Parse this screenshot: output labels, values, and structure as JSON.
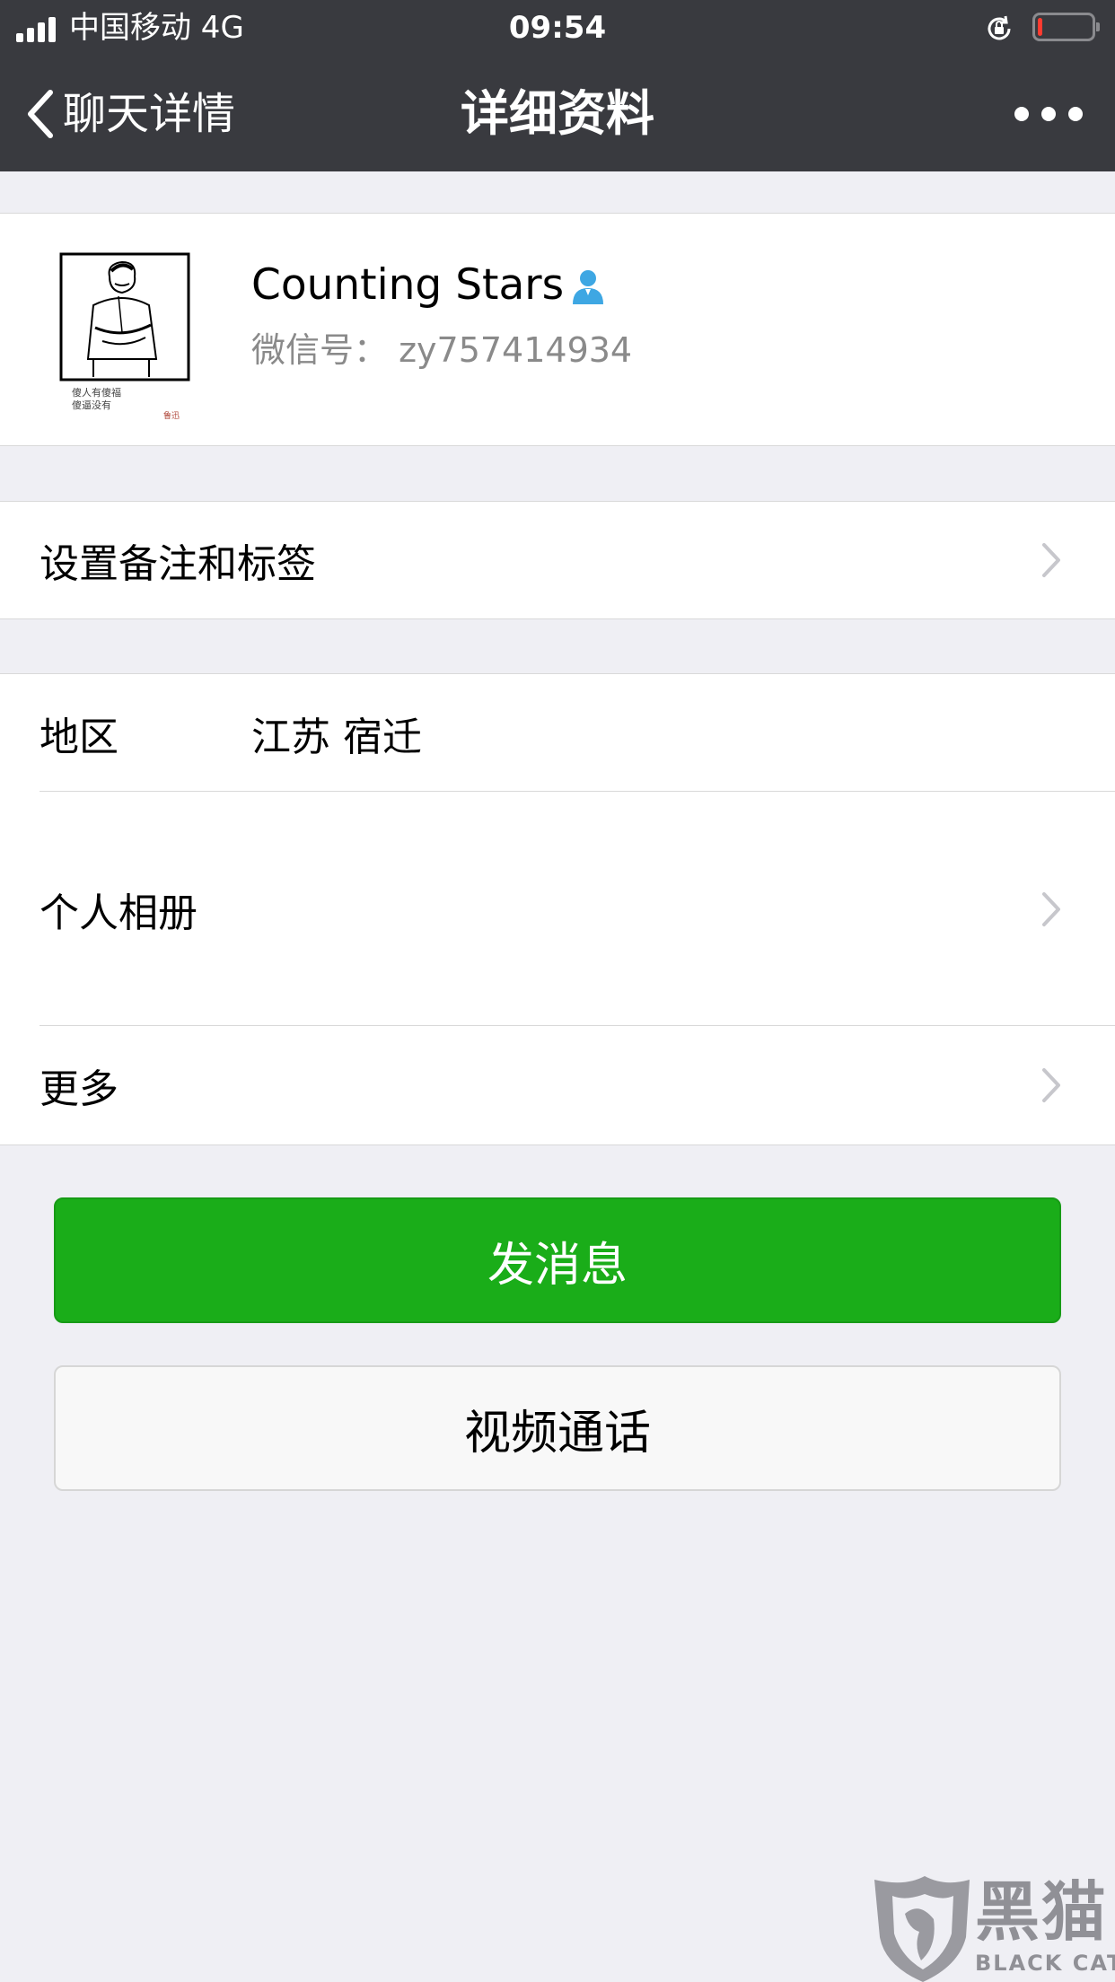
{
  "status_bar": {
    "carrier": "中国移动   4G",
    "time": "09:54",
    "battery_level": 0.08
  },
  "nav": {
    "back_label": "聊天详情",
    "title": "详细资料",
    "more_icon": "more-dots-icon"
  },
  "profile": {
    "name": "Counting Stars",
    "wechat_id": "微信号：  zy757414934",
    "avatar_icon": "avatar-sketch-portrait",
    "avatar_caption_line1": "傻人有傻福",
    "avatar_caption_line2": "傻逼没有",
    "avatar_signature": "鲁迅",
    "contact_icon": "contact-person-icon"
  },
  "rows": {
    "remark_tags": "设置备注和标签",
    "region_label": "地区",
    "region_value": "江苏 宿迁",
    "album": "个人相册",
    "more": "更多"
  },
  "buttons": {
    "send_message": "发消息",
    "video_call": "视频通话"
  },
  "watermark": {
    "text": "黑猫",
    "subtext": "BLACK CAT"
  },
  "colors": {
    "nav_bg": "#393a3f",
    "primary_green": "#1aad19",
    "page_bg": "#efeff4",
    "contact_icon_blue": "#3ea7e3"
  }
}
